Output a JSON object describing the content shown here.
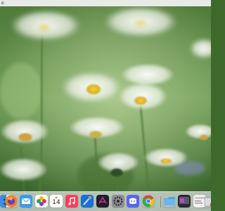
{
  "window": {
    "title": "o"
  },
  "dock": {
    "calendar_day": "14",
    "apps": [
      {
        "name": "finder"
      },
      {
        "name": "firefox"
      },
      {
        "name": "mail"
      },
      {
        "name": "photos"
      },
      {
        "name": "calendar"
      },
      {
        "name": "music"
      },
      {
        "name": "xcode"
      },
      {
        "name": "app-store"
      },
      {
        "name": "settings"
      },
      {
        "name": "discord"
      },
      {
        "name": "chrome"
      },
      {
        "name": "downloads-folder"
      },
      {
        "name": "window-thumbnail-1"
      },
      {
        "name": "window-thumbnail-2"
      },
      {
        "name": "trash"
      }
    ]
  },
  "colors": {
    "accent": "#e53935",
    "folder": "#4fa3e8"
  }
}
